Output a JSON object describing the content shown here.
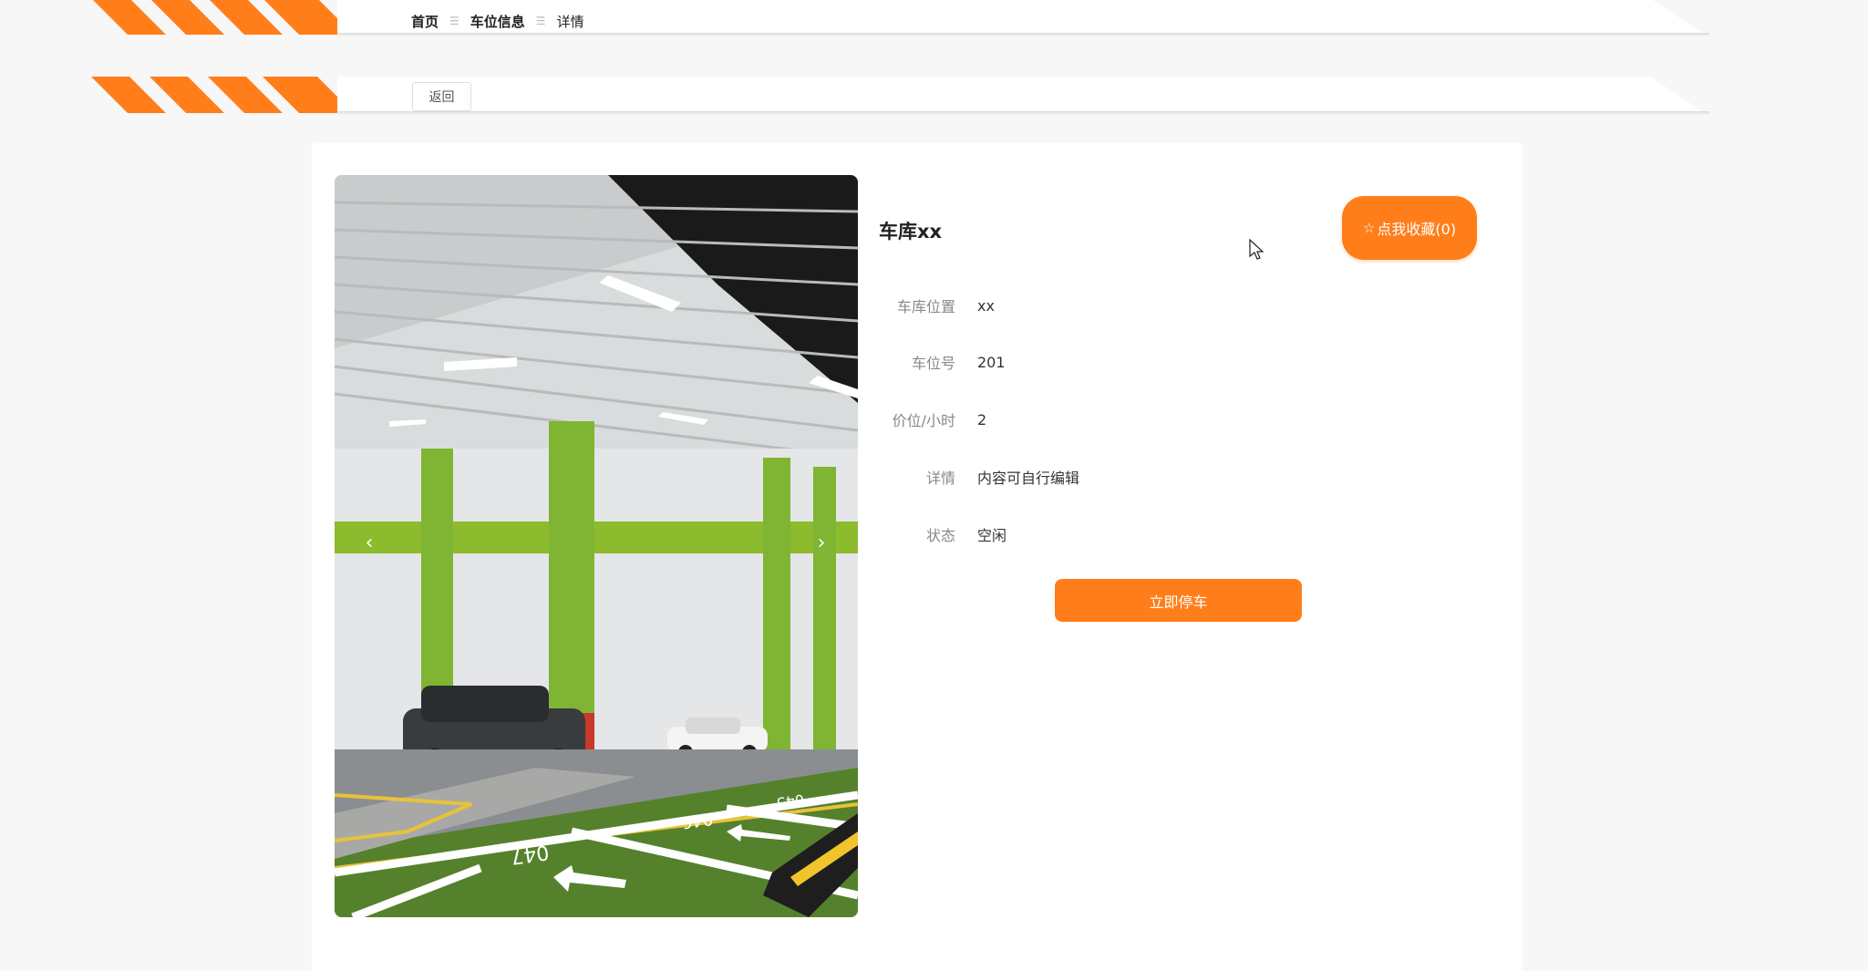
{
  "breadcrumb": {
    "home": "首页",
    "section": "车位信息",
    "current": "详情",
    "separator": "☰"
  },
  "actions": {
    "back_label": "返回",
    "favorite_label": "点我收藏(0)",
    "favorite_icon": "star-outline-icon",
    "park_label": "立即停车"
  },
  "detail": {
    "title": "车库xx",
    "fields": [
      {
        "label": "车库位置",
        "value": "xx"
      },
      {
        "label": "车位号",
        "value": "201"
      },
      {
        "label": "价位/小时",
        "value": "2"
      },
      {
        "label": "详情",
        "value": "内容可自行编辑"
      },
      {
        "label": "状态",
        "value": "空闲"
      }
    ]
  },
  "carousel": {
    "prev_icon": "‹",
    "next_icon": "›",
    "image_alt": "underground parking garage with green floor",
    "bay_numbers": [
      "047",
      "046",
      "045"
    ]
  },
  "colors": {
    "accent": "#ff7e1a",
    "background": "#f7f7f8"
  }
}
